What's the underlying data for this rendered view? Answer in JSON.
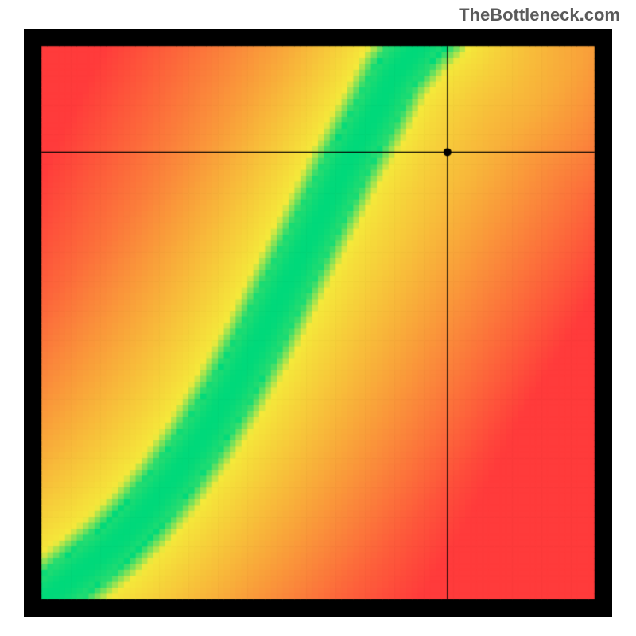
{
  "watermark": "TheBottleneck.com",
  "chart_data": {
    "type": "heatmap",
    "title": "",
    "xlabel": "",
    "ylabel": "",
    "xlim": [
      0,
      100
    ],
    "ylim": [
      0,
      100
    ],
    "grid": false,
    "legend_position": "none",
    "annotations": [],
    "color_scale": {
      "optimal": "#00d97a",
      "near": "#f5e93a",
      "far": "#ff3b3b",
      "outside": "#000000"
    },
    "optimal_curve": {
      "description": "Green band center (optimal pairing) as y for sampled x, percent scale 0-100",
      "x": [
        0,
        5,
        10,
        15,
        20,
        25,
        30,
        35,
        40,
        45,
        50,
        55,
        60,
        63,
        67,
        70
      ],
      "y": [
        0,
        4,
        8,
        12,
        17,
        23,
        30,
        38,
        47,
        57,
        67,
        77,
        86,
        92,
        97,
        100
      ]
    },
    "band_halfwidth_percent": 3.5,
    "crosshair": {
      "x": 72.0,
      "y": 79.0
    },
    "marker": {
      "x": 72.0,
      "y": 79.0,
      "radius_px": 5
    },
    "outer_border_percent": 3.0,
    "pixelation_cells": 100
  }
}
